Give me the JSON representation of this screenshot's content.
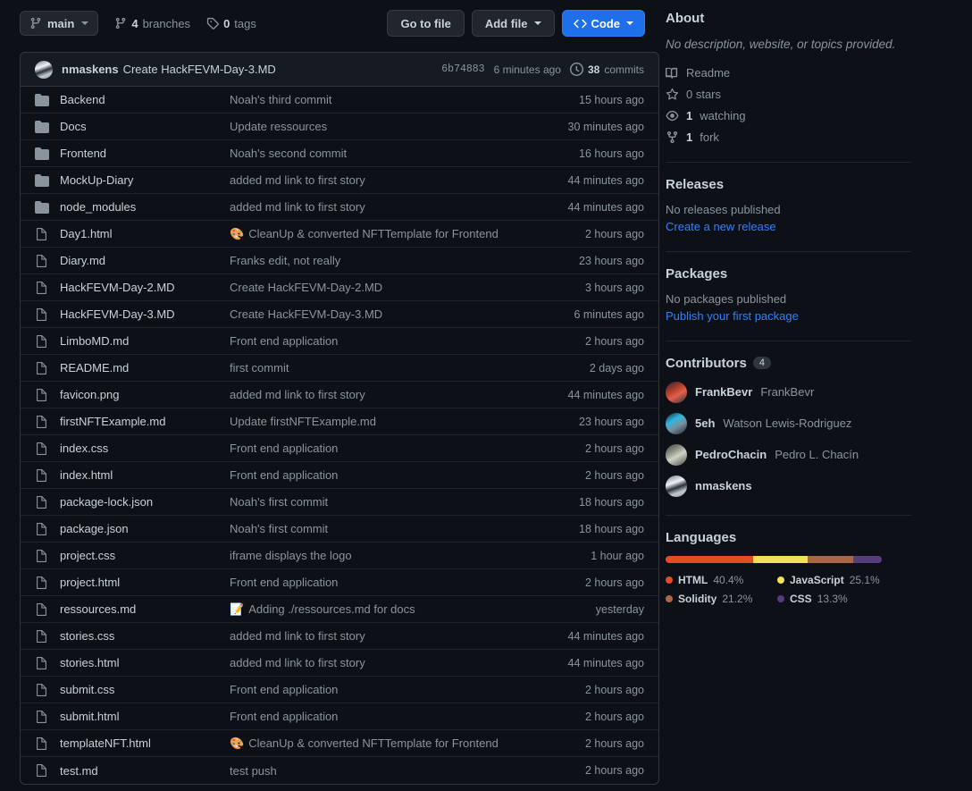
{
  "toolbar": {
    "branch": "main",
    "branches_count": "4",
    "branches_label": "branches",
    "tags_count": "0",
    "tags_label": "tags",
    "go_to_file": "Go to file",
    "add_file": "Add file",
    "code": "Code"
  },
  "commit_bar": {
    "author": "nmaskens",
    "message": "Create HackFEVM-Day-3.MD",
    "sha": "6b74883",
    "age": "6 minutes ago",
    "commits_count": "38",
    "commits_label": "commits"
  },
  "files": [
    {
      "type": "dir",
      "name": "Backend",
      "message": "Noah's third commit",
      "emoji": "",
      "age": "15 hours ago"
    },
    {
      "type": "dir",
      "name": "Docs",
      "message": "Update ressources",
      "emoji": "",
      "age": "30 minutes ago"
    },
    {
      "type": "dir",
      "name": "Frontend",
      "message": "Noah's second commit",
      "emoji": "",
      "age": "16 hours ago"
    },
    {
      "type": "dir",
      "name": "MockUp-Diary",
      "message": "added md link to first story",
      "emoji": "",
      "age": "44 minutes ago"
    },
    {
      "type": "dir",
      "name": "node_modules",
      "message": "added md link to first story",
      "emoji": "",
      "age": "44 minutes ago"
    },
    {
      "type": "file",
      "name": "Day1.html",
      "message": "CleanUp & converted NFTTemplate for Frontend",
      "emoji": "🎨",
      "age": "2 hours ago"
    },
    {
      "type": "file",
      "name": "Diary.md",
      "message": "Franks edit, not really",
      "emoji": "",
      "age": "23 hours ago"
    },
    {
      "type": "file",
      "name": "HackFEVM-Day-2.MD",
      "message": "Create HackFEVM-Day-2.MD",
      "emoji": "",
      "age": "3 hours ago"
    },
    {
      "type": "file",
      "name": "HackFEVM-Day-3.MD",
      "message": "Create HackFEVM-Day-3.MD",
      "emoji": "",
      "age": "6 minutes ago"
    },
    {
      "type": "file",
      "name": "LimboMD.md",
      "message": "Front end application",
      "emoji": "",
      "age": "2 hours ago"
    },
    {
      "type": "file",
      "name": "README.md",
      "message": "first commit",
      "emoji": "",
      "age": "2 days ago"
    },
    {
      "type": "file",
      "name": "favicon.png",
      "message": "added md link to first story",
      "emoji": "",
      "age": "44 minutes ago"
    },
    {
      "type": "file",
      "name": "firstNFTExample.md",
      "message": "Update firstNFTExample.md",
      "emoji": "",
      "age": "23 hours ago"
    },
    {
      "type": "file",
      "name": "index.css",
      "message": "Front end application",
      "emoji": "",
      "age": "2 hours ago"
    },
    {
      "type": "file",
      "name": "index.html",
      "message": "Front end application",
      "emoji": "",
      "age": "2 hours ago"
    },
    {
      "type": "file",
      "name": "package-lock.json",
      "message": "Noah's first commit",
      "emoji": "",
      "age": "18 hours ago"
    },
    {
      "type": "file",
      "name": "package.json",
      "message": "Noah's first commit",
      "emoji": "",
      "age": "18 hours ago"
    },
    {
      "type": "file",
      "name": "project.css",
      "message": "iframe displays the logo",
      "emoji": "",
      "age": "1 hour ago"
    },
    {
      "type": "file",
      "name": "project.html",
      "message": "Front end application",
      "emoji": "",
      "age": "2 hours ago"
    },
    {
      "type": "file",
      "name": "ressources.md",
      "message": "Adding ./ressources.md for docs",
      "emoji": "📝",
      "age": "yesterday"
    },
    {
      "type": "file",
      "name": "stories.css",
      "message": "added md link to first story",
      "emoji": "",
      "age": "44 minutes ago"
    },
    {
      "type": "file",
      "name": "stories.html",
      "message": "added md link to first story",
      "emoji": "",
      "age": "44 minutes ago"
    },
    {
      "type": "file",
      "name": "submit.css",
      "message": "Front end application",
      "emoji": "",
      "age": "2 hours ago"
    },
    {
      "type": "file",
      "name": "submit.html",
      "message": "Front end application",
      "emoji": "",
      "age": "2 hours ago"
    },
    {
      "type": "file",
      "name": "templateNFT.html",
      "message": "CleanUp & converted NFTTemplate for Frontend",
      "emoji": "🎨",
      "age": "2 hours ago"
    },
    {
      "type": "file",
      "name": "test.md",
      "message": "test push",
      "emoji": "",
      "age": "2 hours ago"
    }
  ],
  "about": {
    "heading": "About",
    "description": "No description, website, or topics provided.",
    "readme": "Readme",
    "stars": "0 stars",
    "stars_count": "0",
    "stars_word": "stars",
    "watching_count": "1",
    "watching_word": "watching",
    "forks_count": "1",
    "forks_word": "fork"
  },
  "releases": {
    "heading": "Releases",
    "empty": "No releases published",
    "action": "Create a new release"
  },
  "packages": {
    "heading": "Packages",
    "empty": "No packages published",
    "action": "Publish your first package"
  },
  "contributors": {
    "heading": "Contributors",
    "count": "4",
    "items": [
      {
        "login": "FrankBevr",
        "realname": "FrankBevr",
        "avatar": "av-frank"
      },
      {
        "login": "5eh",
        "realname": "Watson Lewis-Rodriguez",
        "avatar": "av-5eh"
      },
      {
        "login": "PedroChacin",
        "realname": "Pedro L. Chacín",
        "avatar": "av-pedro"
      },
      {
        "login": "nmaskens",
        "realname": "",
        "avatar": "av-nmaskens"
      }
    ]
  },
  "languages": {
    "heading": "Languages",
    "items": [
      {
        "name": "HTML",
        "percent": "40.4%",
        "value": 40.4,
        "color": "#e34c26"
      },
      {
        "name": "JavaScript",
        "percent": "25.1%",
        "value": 25.1,
        "color": "#f1e05a"
      },
      {
        "name": "Solidity",
        "percent": "21.2%",
        "value": 21.2,
        "color": "#aa6746"
      },
      {
        "name": "CSS",
        "percent": "13.3%",
        "value": 13.3,
        "color": "#563d7c"
      }
    ]
  }
}
